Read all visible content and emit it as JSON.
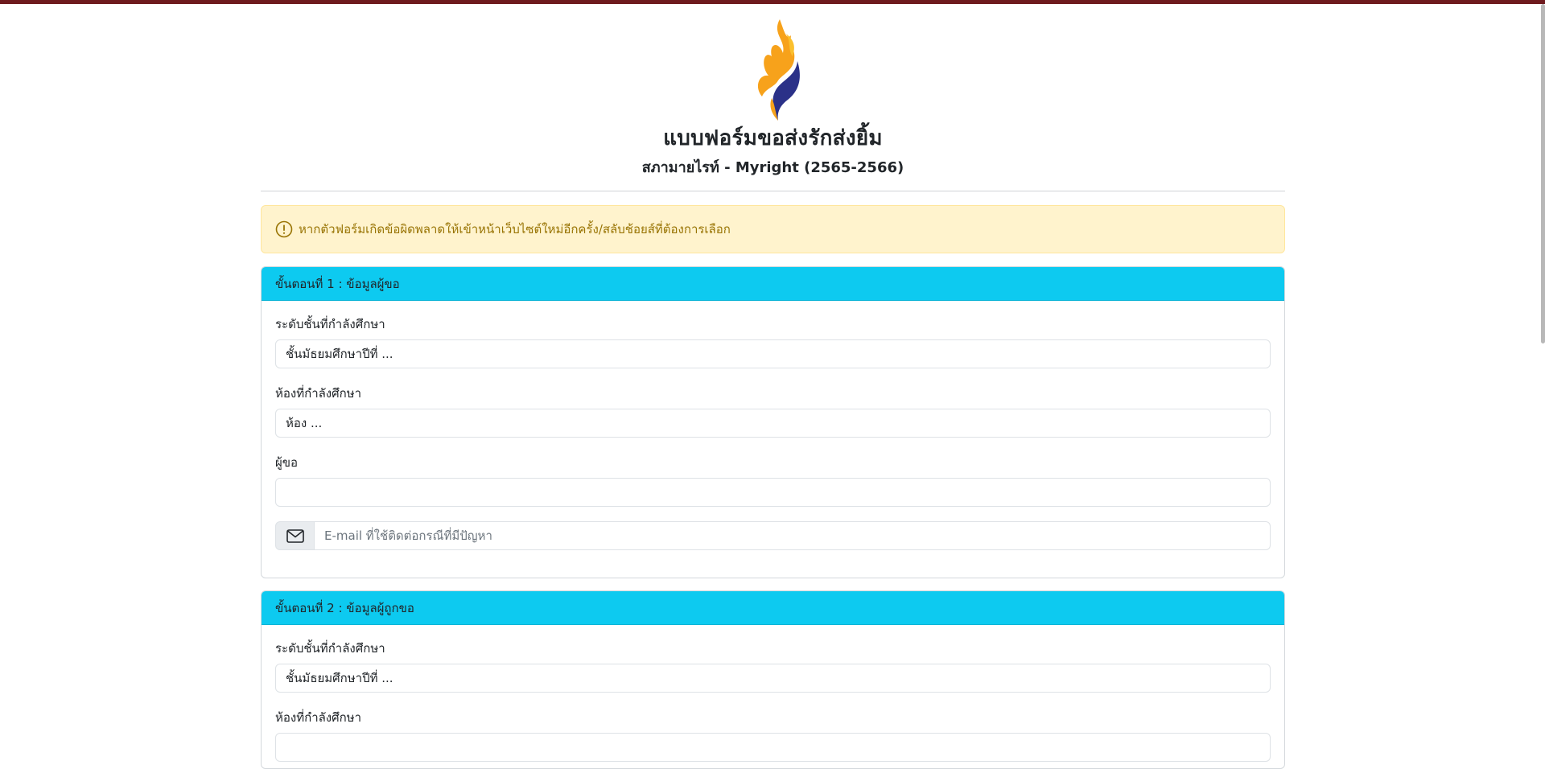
{
  "header": {
    "logo_icon": "flame-bird-logo-icon",
    "title": "แบบฟอร์มขอส่งรักส่งยิ้ม",
    "subtitle": "สภามายไรท์ - Myright (2565-2566)"
  },
  "alert": {
    "icon": "exclamation-circle-icon",
    "text": "หากตัวฟอร์มเกิดข้อผิดพลาดให้เข้าหน้าเว็บไซต์ใหม่อีกครั้ง/สลับช้อยส์ที่ต้องการเลือก"
  },
  "step1": {
    "header": "ขั้นตอนที่ 1 : ข้อมูลผู้ขอ",
    "grade_label": "ระดับชั้นที่กำลังศึกษา",
    "grade_value": "ชั้นมัธยมศึกษาปีที่ ...",
    "room_label": "ห้องที่กำลังศึกษา",
    "room_value": "ห้อง ...",
    "requester_label": "ผู้ขอ",
    "requester_value": "",
    "email_icon": "envelope-icon",
    "email_placeholder": "E-mail ที่ใช้ติดต่อกรณีที่มีปัญหา"
  },
  "step2": {
    "header": "ขั้นตอนที่ 2 : ข้อมูลผู้ถูกขอ",
    "grade_label": "ระดับชั้นที่กำลังศึกษา",
    "grade_value": "ชั้นมัธยมศึกษาปีที่ ...",
    "room_label": "ห้องที่กำลังศึกษา"
  },
  "colors": {
    "top_bar": "#6e1a1e",
    "card_header": "#0dcaf0",
    "alert_bg": "#fff3cd",
    "alert_text": "#997404"
  }
}
